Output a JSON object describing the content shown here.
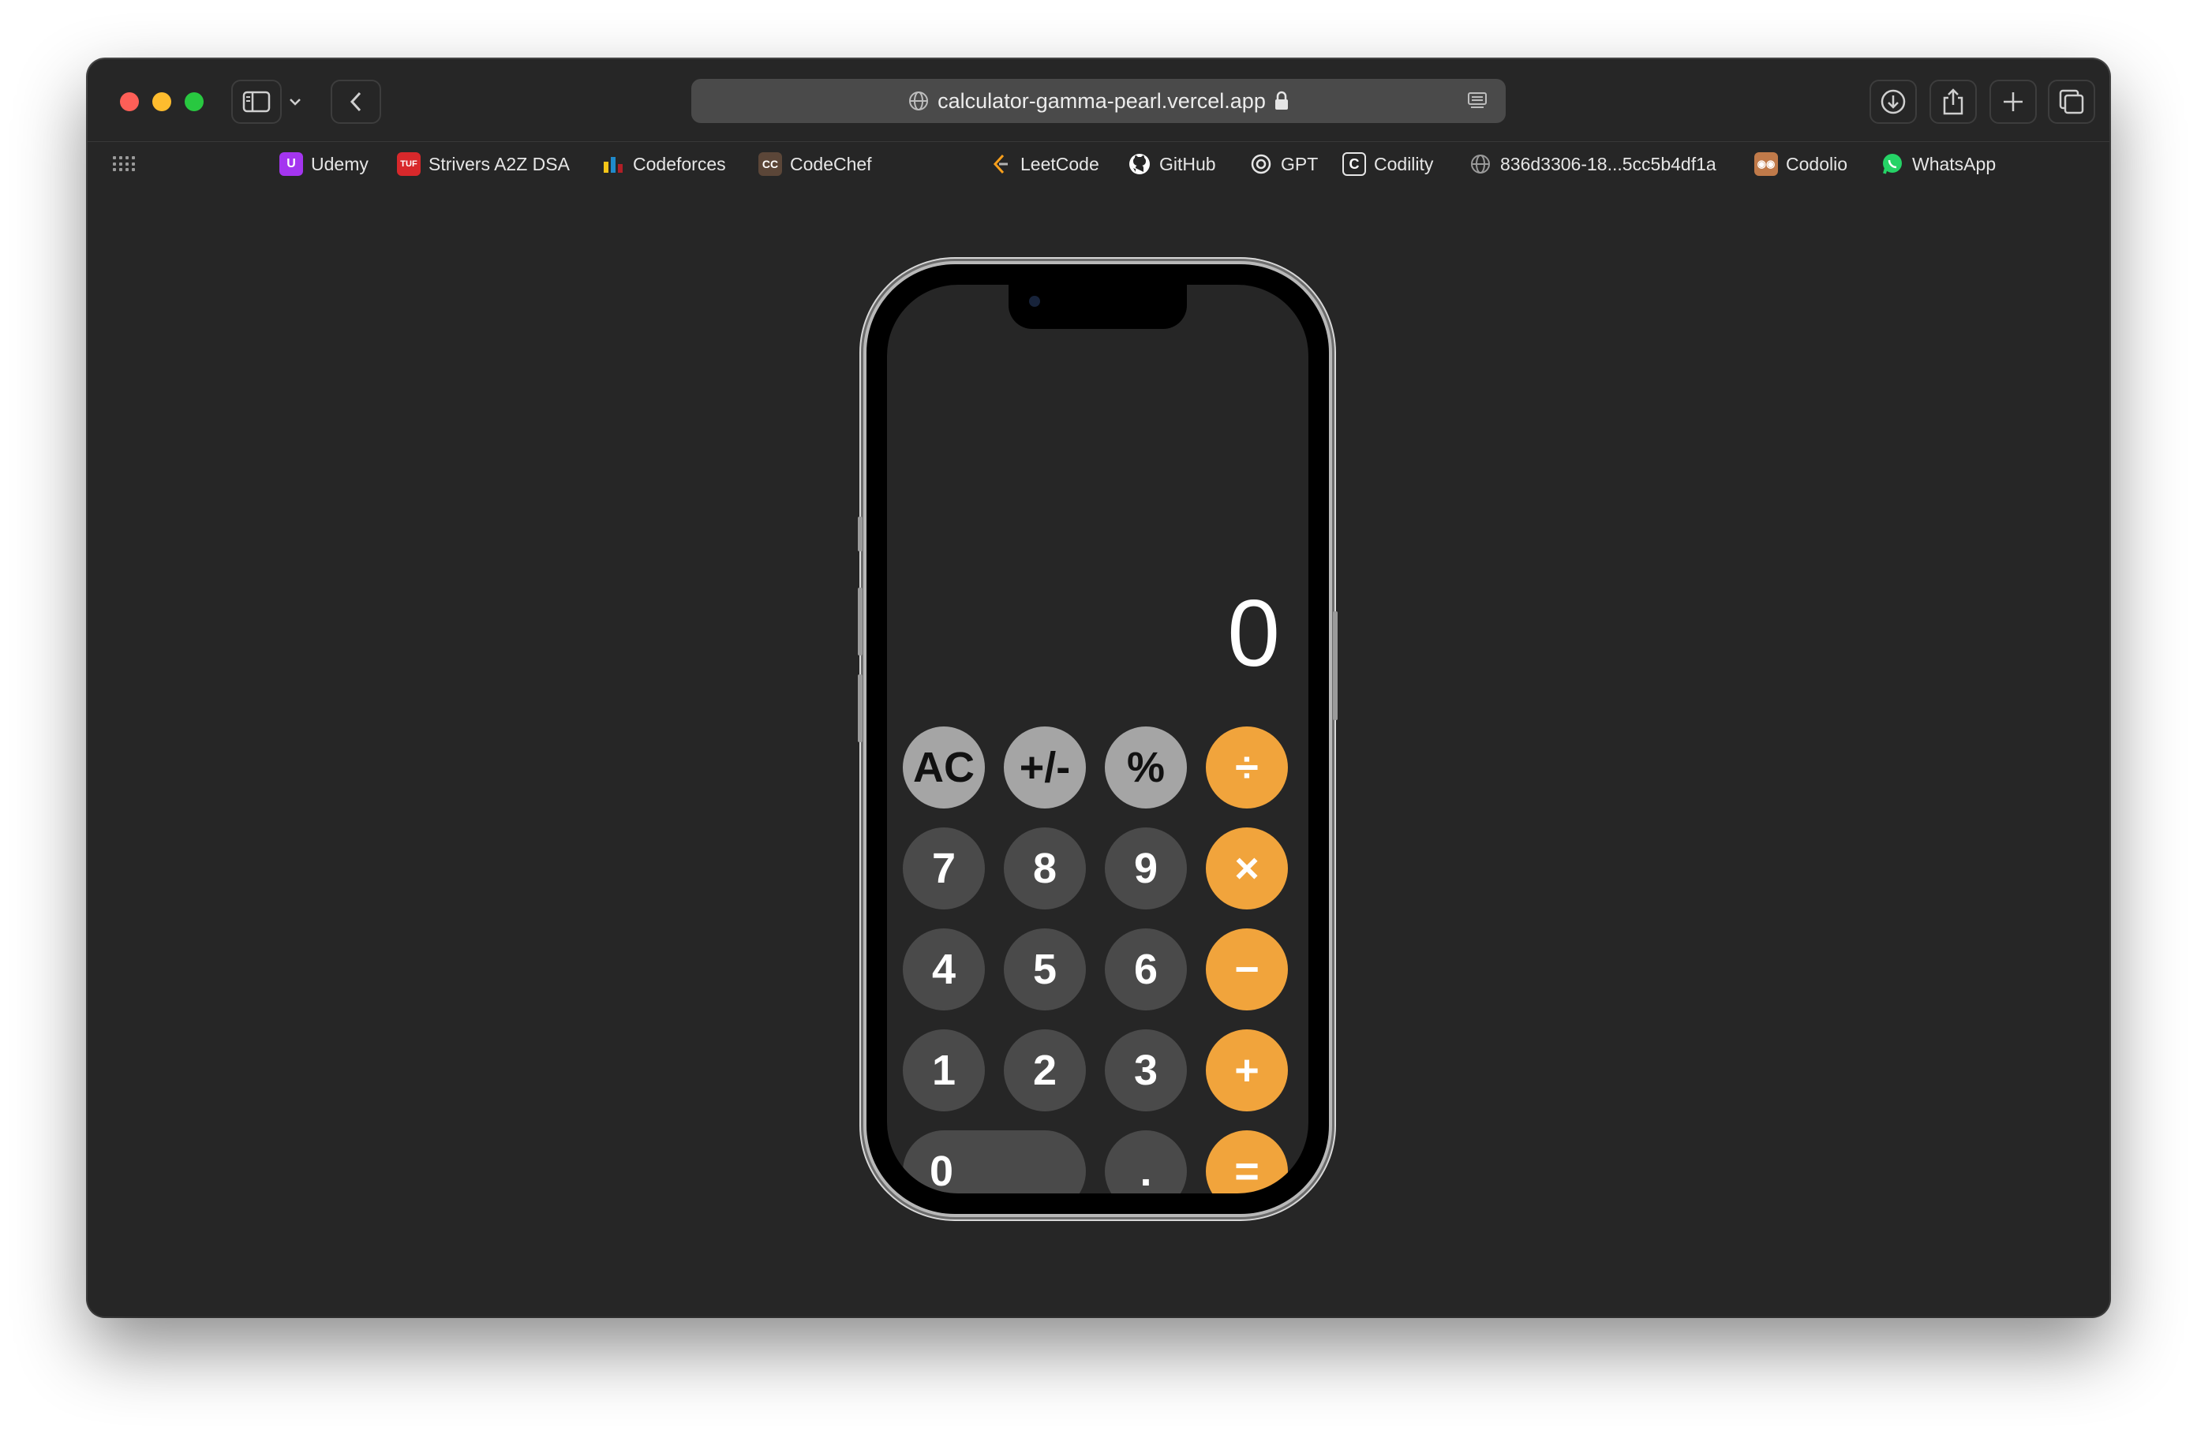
{
  "browser": {
    "url": "calculator-gamma-pearl.vercel.app",
    "bookmarks": [
      {
        "label": "Udemy",
        "icon": "udemy-icon",
        "color": "#a435f0"
      },
      {
        "label": "Strivers A2Z DSA",
        "icon": "tuf-icon",
        "color": "#d8282b"
      },
      {
        "label": "Codeforces",
        "icon": "codeforces-icon",
        "color": "#1f8acb"
      },
      {
        "label": "CodeChef",
        "icon": "codechef-icon",
        "color": "#5b4638"
      },
      {
        "label": "LeetCode",
        "icon": "leetcode-icon",
        "color": "#f89f1b"
      },
      {
        "label": "GitHub",
        "icon": "github-icon",
        "color": "#ffffff"
      },
      {
        "label": "GPT",
        "icon": "openai-icon",
        "color": "#ffffff"
      },
      {
        "label": "Codility",
        "icon": "codility-icon",
        "color": "#ffffff"
      },
      {
        "label": "836d3306-18...5cc5b4df1a",
        "icon": "globe-icon",
        "color": "#9a9a9a"
      },
      {
        "label": "Codolio",
        "icon": "codolio-icon",
        "color": "#c07a4a"
      },
      {
        "label": "WhatsApp",
        "icon": "whatsapp-icon",
        "color": "#25d366"
      }
    ]
  },
  "calculator": {
    "display": "0",
    "keys": {
      "ac": "AC",
      "sign": "+/-",
      "percent": "%",
      "divide": "÷",
      "seven": "7",
      "eight": "8",
      "nine": "9",
      "multiply": "×",
      "four": "4",
      "five": "5",
      "six": "6",
      "minus": "−",
      "one": "1",
      "two": "2",
      "three": "3",
      "plus": "+",
      "zero": "0",
      "dot": ".",
      "equals": "="
    }
  },
  "colors": {
    "operator": "#f1a43c",
    "function": "#a5a5a5",
    "number": "#4a4a4a",
    "background": "#262626"
  }
}
